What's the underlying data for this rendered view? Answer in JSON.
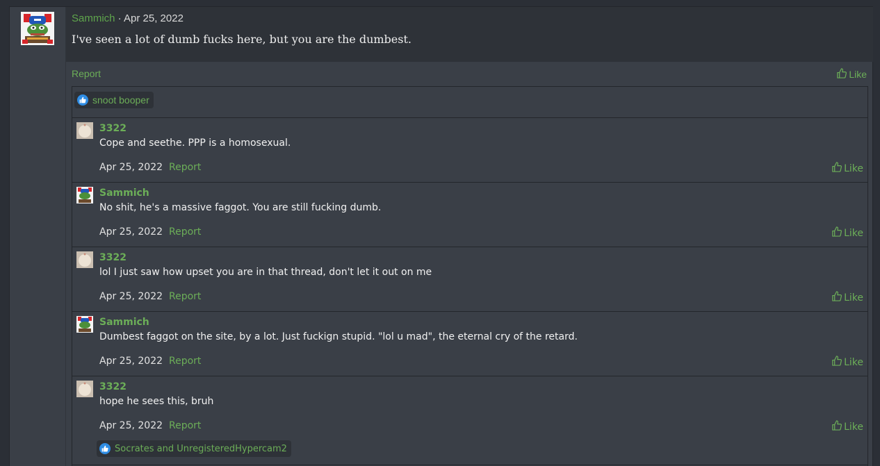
{
  "post": {
    "author": "Sammich",
    "separator": " · ",
    "date": "Apr 25, 2022",
    "body": "I've seen a lot of dumb fucks here, but you are the dumbest.",
    "report_label": "Report",
    "like_label": "Like",
    "reaction_users": "snoot booper"
  },
  "comments": [
    {
      "author": "3322",
      "text": "Cope and seethe. PPP is a homosexual.",
      "date": "Apr 25, 2022",
      "report": "Report",
      "like": "Like"
    },
    {
      "author": "Sammich",
      "text": "No shit, he's a massive faggot. You are still fucking dumb.",
      "date": "Apr 25, 2022",
      "report": "Report",
      "like": "Like"
    },
    {
      "author": "3322",
      "text": "lol I just saw how upset you are in that thread, don't let it out on me",
      "date": "Apr 25, 2022",
      "report": "Report",
      "like": "Like"
    },
    {
      "author": "Sammich",
      "text": "Dumbest faggot on the site, by a lot. Just fuckign stupid. \"lol u mad\", the eternal cry of the retard.",
      "date": "Apr 25, 2022",
      "report": "Report",
      "like": "Like"
    },
    {
      "author": "3322",
      "text": "hope he sees this, bruh",
      "date": "Apr 25, 2022",
      "report": "Report",
      "like": "Like",
      "reactions": "Socrates and UnregisteredHypercam2"
    }
  ],
  "colors": {
    "accent": "#6cae58",
    "background": "#3a3f47",
    "header": "#2e3238",
    "like_badge": "#2f8de4"
  }
}
